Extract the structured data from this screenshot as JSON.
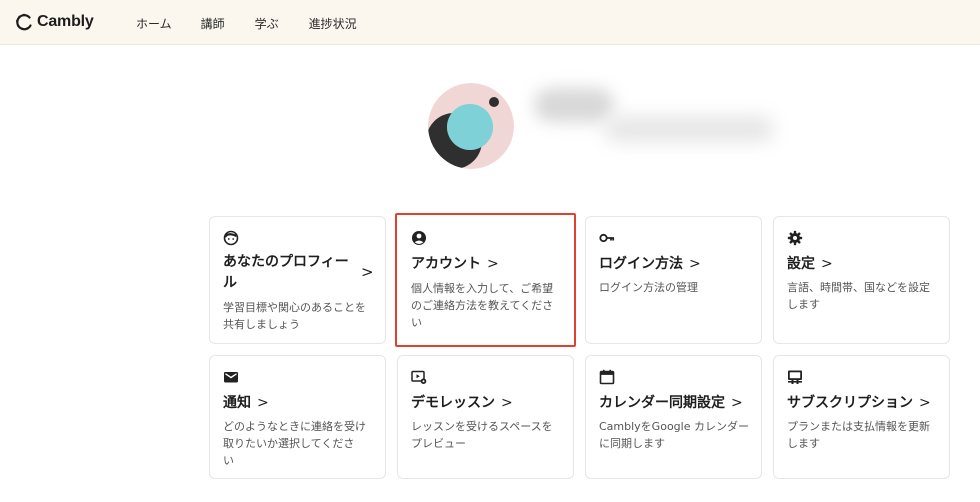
{
  "header": {
    "logo_text": "Cambly",
    "nav": [
      "ホーム",
      "講師",
      "学ぶ",
      "進捗状況"
    ]
  },
  "profile": {
    "avatar_colors": {
      "bg": "#f1d6d6",
      "teal": "#5cc4cc",
      "light_teal": "#9ddde2",
      "dark": "#2f2f2f"
    }
  },
  "cards": [
    {
      "title": "あなたのプロフィール",
      "title_line1": "あなたのプロフィー",
      "title_line2": "ル",
      "desc_line1": "学習目標や関心のあることを",
      "desc_line2": "共有しましょう",
      "icon": "face-icon"
    },
    {
      "title": "アカウント",
      "desc_line1": "個人情報を入力して、ご希望",
      "desc_line2": "のご連絡方法を教えてくださ",
      "desc_line3": "い",
      "icon": "account-circle-icon"
    },
    {
      "title": "ログイン方法",
      "desc_line1": "ログイン方法の管理",
      "icon": "key-icon"
    },
    {
      "title": "設定",
      "desc_line1": "言語、時間帯、国などを設定",
      "desc_line2": "します",
      "icon": "gear-icon"
    },
    {
      "title": "通知",
      "desc_line1": "どのようなときに連絡を受け",
      "desc_line2": "取りたいか選択してくださ",
      "desc_line3": "い",
      "icon": "mail-icon"
    },
    {
      "title": "デモレッスン",
      "desc_line1": "レッスンを受けるスペースを",
      "desc_line2": "プレビュー",
      "icon": "video-settings-icon"
    },
    {
      "title": "カレンダー同期設定",
      "desc_line1": "CamblyをGoogle カレンダー",
      "desc_line2": "に同期します",
      "icon": "calendar-icon"
    },
    {
      "title": "サブスクリプション",
      "desc_line1": "プランまたは支払情報を更新",
      "desc_line2": "します",
      "icon": "subscription-icon"
    }
  ],
  "chevron": ">"
}
